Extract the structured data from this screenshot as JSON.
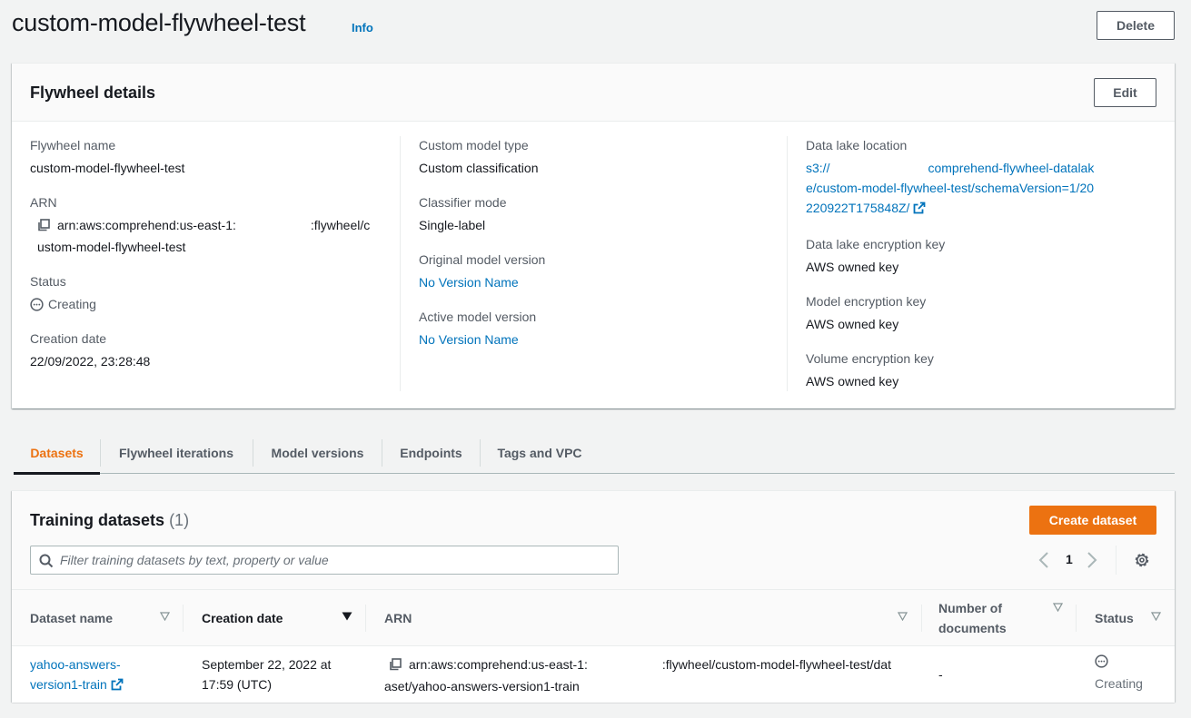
{
  "header": {
    "title": "custom-model-flywheel-test",
    "info_label": "Info",
    "delete_label": "Delete"
  },
  "details": {
    "title": "Flywheel details",
    "edit_label": "Edit",
    "column1": {
      "flywheel_name_label": "Flywheel name",
      "flywheel_name": "custom-model-flywheel-test",
      "arn_label": "ARN",
      "arn_part1": "arn:aws:comprehend:us-east-1:",
      "arn_part2": ":flywheel/custom-model-flywheel-test",
      "status_label": "Status",
      "status": "Creating",
      "creation_date_label": "Creation date",
      "creation_date": "22/09/2022, 23:28:48"
    },
    "column2": {
      "model_type_label": "Custom model type",
      "model_type": "Custom classification",
      "classifier_mode_label": "Classifier mode",
      "classifier_mode": "Single-label",
      "original_version_label": "Original model version",
      "original_version": "No Version Name",
      "active_version_label": "Active model version",
      "active_version": "No Version Name"
    },
    "column3": {
      "data_lake_label": "Data lake location",
      "data_lake_part1": "s3://",
      "data_lake_part2": "comprehend-flywheel-datalake/custom-model-flywheel-test/schemaVersion=1/20220922T175848Z/",
      "data_lake_key_label": "Data lake encryption key",
      "data_lake_key": "AWS owned key",
      "model_key_label": "Model encryption key",
      "model_key": "AWS owned key",
      "volume_key_label": "Volume encryption key",
      "volume_key": "AWS owned key"
    }
  },
  "tabs": [
    {
      "label": "Datasets",
      "active": true
    },
    {
      "label": "Flywheel iterations",
      "active": false
    },
    {
      "label": "Model versions",
      "active": false
    },
    {
      "label": "Endpoints",
      "active": false
    },
    {
      "label": "Tags and VPC",
      "active": false
    }
  ],
  "datasets": {
    "title": "Training datasets",
    "count": "(1)",
    "create_label": "Create dataset",
    "filter_placeholder": "Filter training datasets by text, property or value",
    "filter_value": "",
    "current_page": "1",
    "columns": [
      {
        "label": "Dataset name",
        "sort": "none"
      },
      {
        "label": "Creation date",
        "sort": "descending"
      },
      {
        "label": "ARN",
        "sort": "none"
      },
      {
        "label": "Number of documents",
        "sort": "none"
      },
      {
        "label": "Status",
        "sort": "none"
      }
    ],
    "rows": [
      {
        "dataset_name": "yahoo-answers-version1-train",
        "creation_date": "September 22, 2022 at 17:59 (UTC)",
        "arn_part1": "arn:aws:comprehend:us-east-1:",
        "arn_part2": ":flywheel/custom-model-flywheel-test/dataset/yahoo-answers-version1-train",
        "num_documents": "-",
        "status": "Creating"
      }
    ]
  },
  "colors": {
    "accent_orange": "#ec7211",
    "link_blue": "#0073bb",
    "text_primary": "#16191f",
    "text_secondary": "#545b64",
    "background": "#f2f3f3"
  }
}
